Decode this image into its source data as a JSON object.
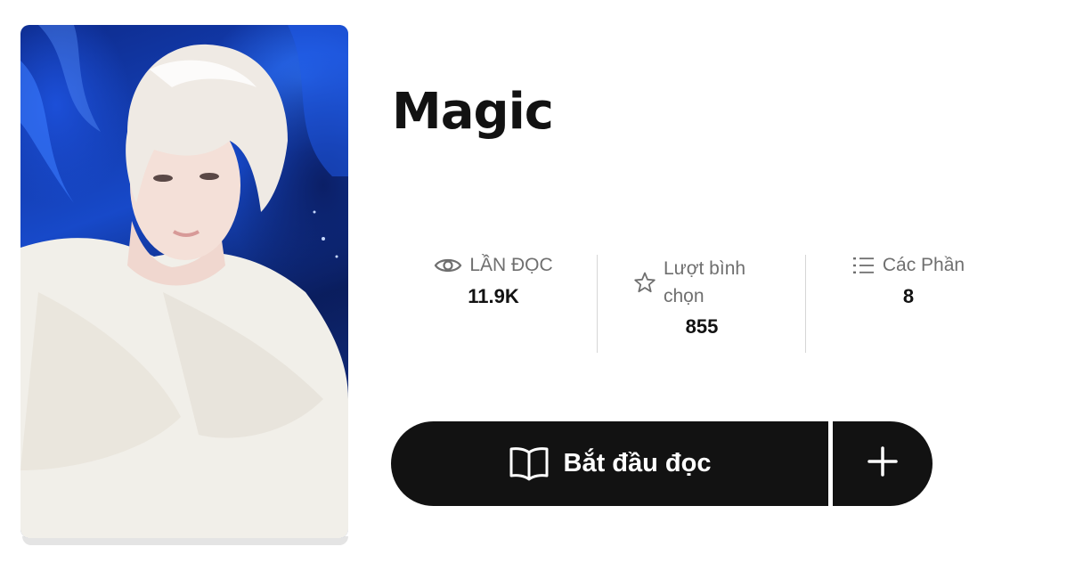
{
  "story": {
    "title": "Magic"
  },
  "stats": {
    "reads": {
      "label": "LẦN ĐỌC",
      "value": "11.9K",
      "icon": "eye-icon"
    },
    "votes": {
      "label": "Lượt bình chọn",
      "value": "855",
      "icon": "star-icon"
    },
    "parts": {
      "label": "Các Phần",
      "value": "8",
      "icon": "list-icon"
    }
  },
  "actions": {
    "start_reading_label": "Bắt đầu đọc",
    "start_reading_icon": "book-open-icon",
    "add_icon": "plus-icon"
  },
  "colors": {
    "button_bg": "#121212",
    "muted_text": "#6f6f6f",
    "divider": "#d6d6d6"
  }
}
